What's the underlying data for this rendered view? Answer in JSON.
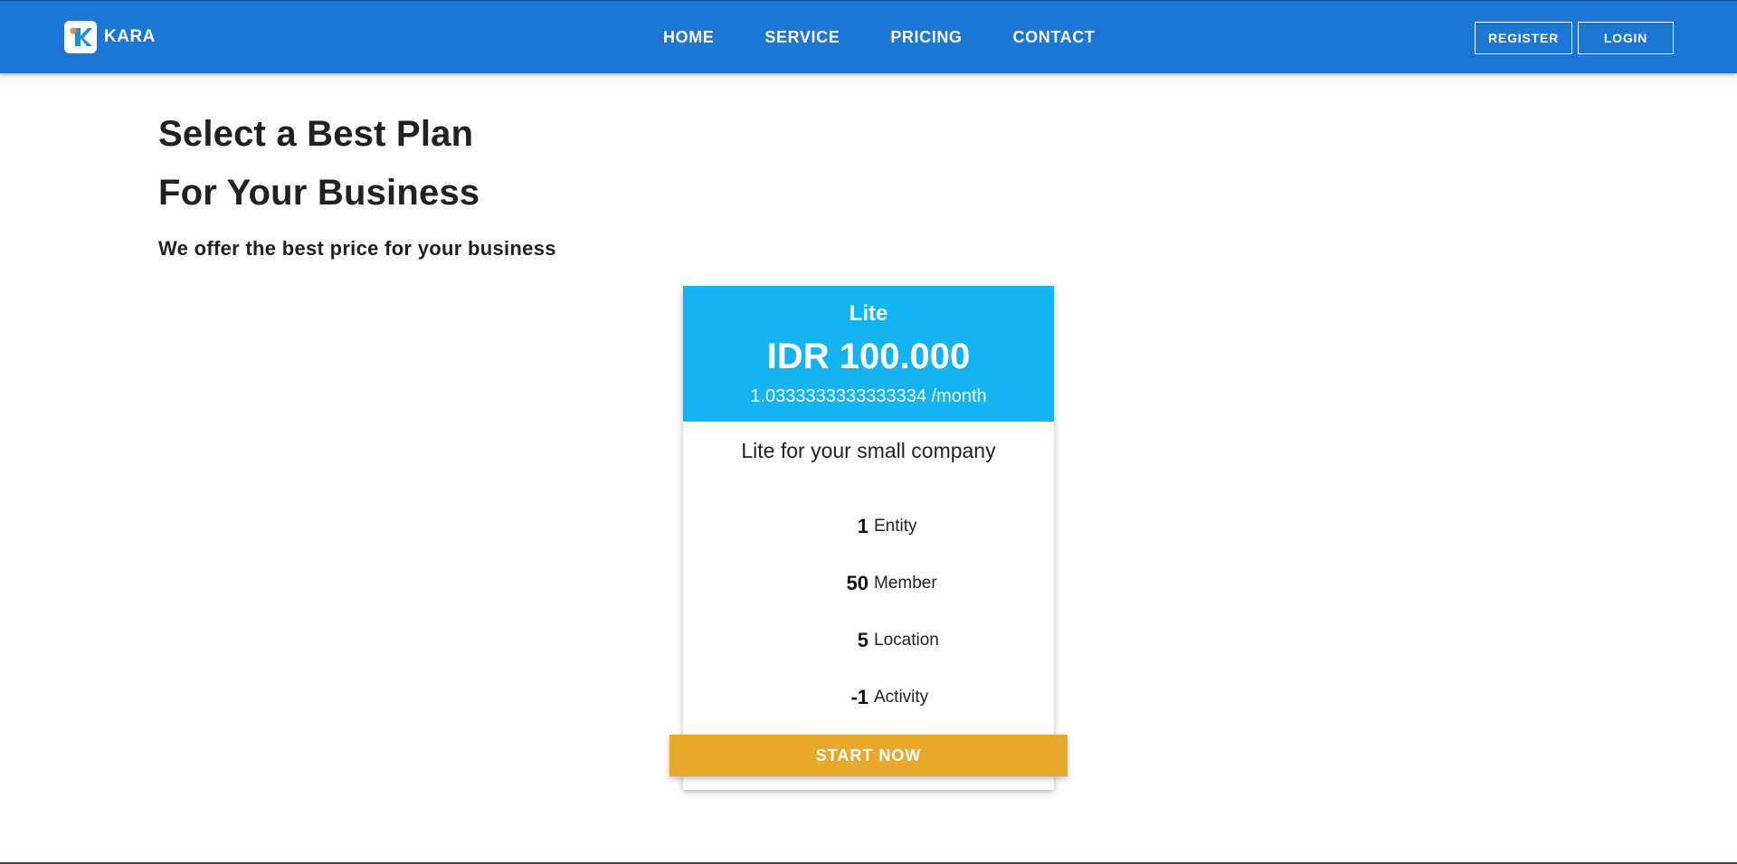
{
  "navbar": {
    "brand": "KARA",
    "links": [
      "HOME",
      "SERVICE",
      "PRICING",
      "CONTACT"
    ],
    "register_label": "REGISTER",
    "login_label": "LOGIN",
    "color": "#1c77d4"
  },
  "hero": {
    "title_line1": "Select a Best Plan",
    "title_line2": "For Your Business",
    "subtitle": "We offer the best price for your business"
  },
  "plan": {
    "name": "Lite",
    "price": "IDR 100.000",
    "period": "1.0333333333333334 /month",
    "description": "Lite for your small company",
    "features": [
      {
        "value": "1",
        "label": "Entity"
      },
      {
        "value": "50",
        "label": "Member"
      },
      {
        "value": "5",
        "label": "Location"
      },
      {
        "value": "-1",
        "label": "Activity"
      }
    ],
    "cta_label": "START NOW",
    "header_color": "#14b4f0",
    "cta_color": "#e8a82c"
  }
}
